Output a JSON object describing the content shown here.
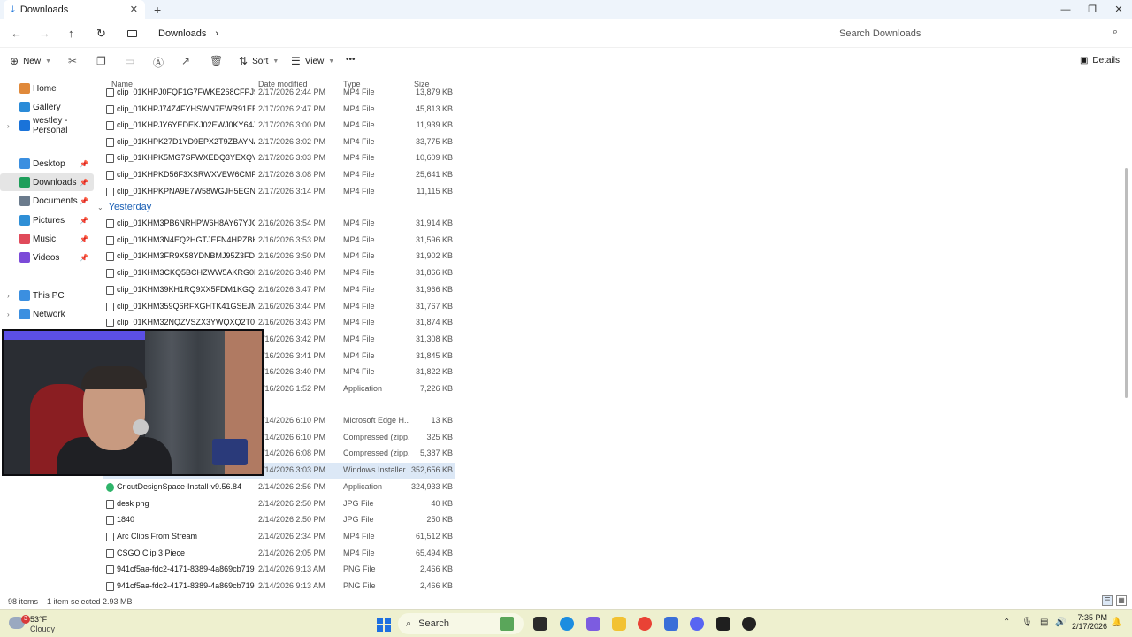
{
  "window": {
    "tab_title": "Downloads",
    "tab_close": "✕",
    "new_tab": "+",
    "controls": [
      "—",
      "❐",
      "✕"
    ]
  },
  "address": {
    "back": "←",
    "forward": "→",
    "up": "↑",
    "refresh": "↻",
    "crumb": "Downloads",
    "crumb_sep": "›",
    "search_placeholder": "Search Downloads"
  },
  "commands": {
    "new_label": "New",
    "sort_label": "Sort",
    "view_label": "View",
    "more": "•••",
    "details_label": "Details"
  },
  "sidebar": {
    "items": [
      {
        "label": "Home",
        "icon": "home-icon",
        "color": "#e0893a",
        "chevron": "",
        "pin": ""
      },
      {
        "label": "Gallery",
        "icon": "gallery-icon",
        "color": "#2a8bd8",
        "chevron": "",
        "pin": ""
      },
      {
        "label": "westley - Personal",
        "icon": "cloud-icon",
        "color": "#1a73d9",
        "chevron": "›",
        "pin": ""
      },
      {
        "label": "Desktop",
        "icon": "desktop-icon",
        "color": "#3b8fe0",
        "chevron": "",
        "pin": "📌"
      },
      {
        "label": "Downloads",
        "icon": "downloads-icon",
        "color": "#1e9e5a",
        "chevron": "",
        "pin": "📌"
      },
      {
        "label": "Documents",
        "icon": "documents-icon",
        "color": "#6b7b8c",
        "chevron": "",
        "pin": "📌"
      },
      {
        "label": "Pictures",
        "icon": "pictures-icon",
        "color": "#2f8fd6",
        "chevron": "",
        "pin": "📌"
      },
      {
        "label": "Music",
        "icon": "music-icon",
        "color": "#e04a5a",
        "chevron": "",
        "pin": "📌"
      },
      {
        "label": "Videos",
        "icon": "videos-icon",
        "color": "#7b4ad8",
        "chevron": "",
        "pin": "📌"
      },
      {
        "label": "This PC",
        "icon": "this-pc-icon",
        "color": "#3b8fe0",
        "chevron": "›",
        "pin": ""
      },
      {
        "label": "Network",
        "icon": "network-icon",
        "color": "#3b8fe0",
        "chevron": "›",
        "pin": ""
      }
    ]
  },
  "columns": {
    "name": "Name",
    "date": "Date modified",
    "type": "Type",
    "size": "Size"
  },
  "group_yesterday": "Yesterday",
  "files_top": [
    {
      "name": "clip_01KHPJ0FQF1G7FWKE268CFPJ9",
      "date": "2/17/2026 2:44 PM",
      "type": "MP4 File",
      "size": "13,879 KB"
    },
    {
      "name": "clip_01KHPJ74Z4FYHSWN7EWR91ERCH",
      "date": "2/17/2026 2:47 PM",
      "type": "MP4 File",
      "size": "45,813 KB"
    },
    {
      "name": "clip_01KHPJY6YEDEKJ02EWJ0KY64J1",
      "date": "2/17/2026 3:00 PM",
      "type": "MP4 File",
      "size": "11,939 KB"
    },
    {
      "name": "clip_01KHPK27D1YD9EPX2T9ZBAYNAN",
      "date": "2/17/2026 3:02 PM",
      "type": "MP4 File",
      "size": "33,775 KB"
    },
    {
      "name": "clip_01KHPK5MG7SFWXEDQ3YEXQV073",
      "date": "2/17/2026 3:03 PM",
      "type": "MP4 File",
      "size": "10,609 KB"
    },
    {
      "name": "clip_01KHPKD56F3XSRWXVEW6CMP6HZ",
      "date": "2/17/2026 3:08 PM",
      "type": "MP4 File",
      "size": "25,641 KB"
    },
    {
      "name": "clip_01KHPKPNA9E7W58WGJH5EGNRCN",
      "date": "2/17/2026 3:14 PM",
      "type": "MP4 File",
      "size": "11,115 KB"
    }
  ],
  "files_yesterday": [
    {
      "name": "clip_01KHM3PB6NRHPW6H8AY67YJG7E",
      "date": "2/16/2026 3:54 PM",
      "type": "MP4 File",
      "size": "31,914 KB"
    },
    {
      "name": "clip_01KHM3N4EQ2HGTJEFN4HPZBK3K",
      "date": "2/16/2026 3:53 PM",
      "type": "MP4 File",
      "size": "31,596 KB"
    },
    {
      "name": "clip_01KHM3FR9X58YDNBMJ95Z3FDMA",
      "date": "2/16/2026 3:50 PM",
      "type": "MP4 File",
      "size": "31,902 KB"
    },
    {
      "name": "clip_01KHM3CKQ5BCHZWW5AKRG0BS3F",
      "date": "2/16/2026 3:48 PM",
      "type": "MP4 File",
      "size": "31,866 KB"
    },
    {
      "name": "clip_01KHM39KH1RQ9XX5FDM1KGQRGY",
      "date": "2/16/2026 3:47 PM",
      "type": "MP4 File",
      "size": "31,966 KB"
    },
    {
      "name": "clip_01KHM359Q6RFXGHTK41GSEJMGM",
      "date": "2/16/2026 3:44 PM",
      "type": "MP4 File",
      "size": "31,767 KB"
    },
    {
      "name": "clip_01KHM32NQZVSZX3YWQXQ2T0HYW",
      "date": "2/16/2026 3:43 PM",
      "type": "MP4 File",
      "size": "31,874 KB"
    },
    {
      "name": "",
      "date": "2/16/2026 3:42 PM",
      "type": "MP4 File",
      "size": "31,308 KB"
    },
    {
      "name": "",
      "date": "2/16/2026 3:41 PM",
      "type": "MP4 File",
      "size": "31,845 KB"
    },
    {
      "name": "",
      "date": "2/16/2026 3:40 PM",
      "type": "MP4 File",
      "size": "31,822 KB"
    },
    {
      "name": "",
      "date": "2/16/2026 1:52 PM",
      "type": "Application",
      "size": "7,226 KB"
    }
  ],
  "files_earlier": [
    {
      "name": "",
      "date": "2/14/2026 6:10 PM",
      "type": "Microsoft Edge H...",
      "size": "13 KB"
    },
    {
      "name": "",
      "date": "2/14/2026 6:10 PM",
      "type": "Compressed (zipp...",
      "size": "325 KB"
    },
    {
      "name": "",
      "date": "2/14/2026 6:08 PM",
      "type": "Compressed (zipp...",
      "size": "5,387 KB"
    },
    {
      "name": "",
      "date": "2/14/2026 3:03 PM",
      "type": "Windows Installer ...",
      "size": "352,656 KB"
    },
    {
      "name": "CricutDesignSpace-Install-v9.56.84",
      "date": "2/14/2026 2:56 PM",
      "type": "Application",
      "size": "324,933 KB"
    },
    {
      "name": "desk png",
      "date": "2/14/2026 2:50 PM",
      "type": "JPG File",
      "size": "40 KB"
    },
    {
      "name": "1840",
      "date": "2/14/2026 2:50 PM",
      "type": "JPG File",
      "size": "250 KB"
    },
    {
      "name": "Arc Clips From Stream",
      "date": "2/14/2026 2:34 PM",
      "type": "MP4 File",
      "size": "61,512 KB"
    },
    {
      "name": "CSGO Clip 3 Piece",
      "date": "2/14/2026 2:05 PM",
      "type": "MP4 File",
      "size": "65,494 KB"
    },
    {
      "name": "941cf5aa-fdc2-4171-8389-4a869cb719b5 ...",
      "date": "2/14/2026 9:13 AM",
      "type": "PNG File",
      "size": "2,466 KB"
    },
    {
      "name": "941cf5aa-fdc2-4171-8389-4a869cb719b5",
      "date": "2/14/2026 9:13 AM",
      "type": "PNG File",
      "size": "2,466 KB"
    }
  ],
  "status": {
    "item_count": "98 items",
    "selection": "1 item selected  2.93 MB"
  },
  "taskbar": {
    "weather_temp": "53°F",
    "weather_cond": "Cloudy",
    "weather_badge": "3",
    "search_label": "Search",
    "time": "7:35 PM",
    "date": "2/17/2026"
  },
  "colors": {
    "accent": "#1a73d9",
    "selected_row": "#dce8f6",
    "taskbar": "#eef0cf"
  }
}
